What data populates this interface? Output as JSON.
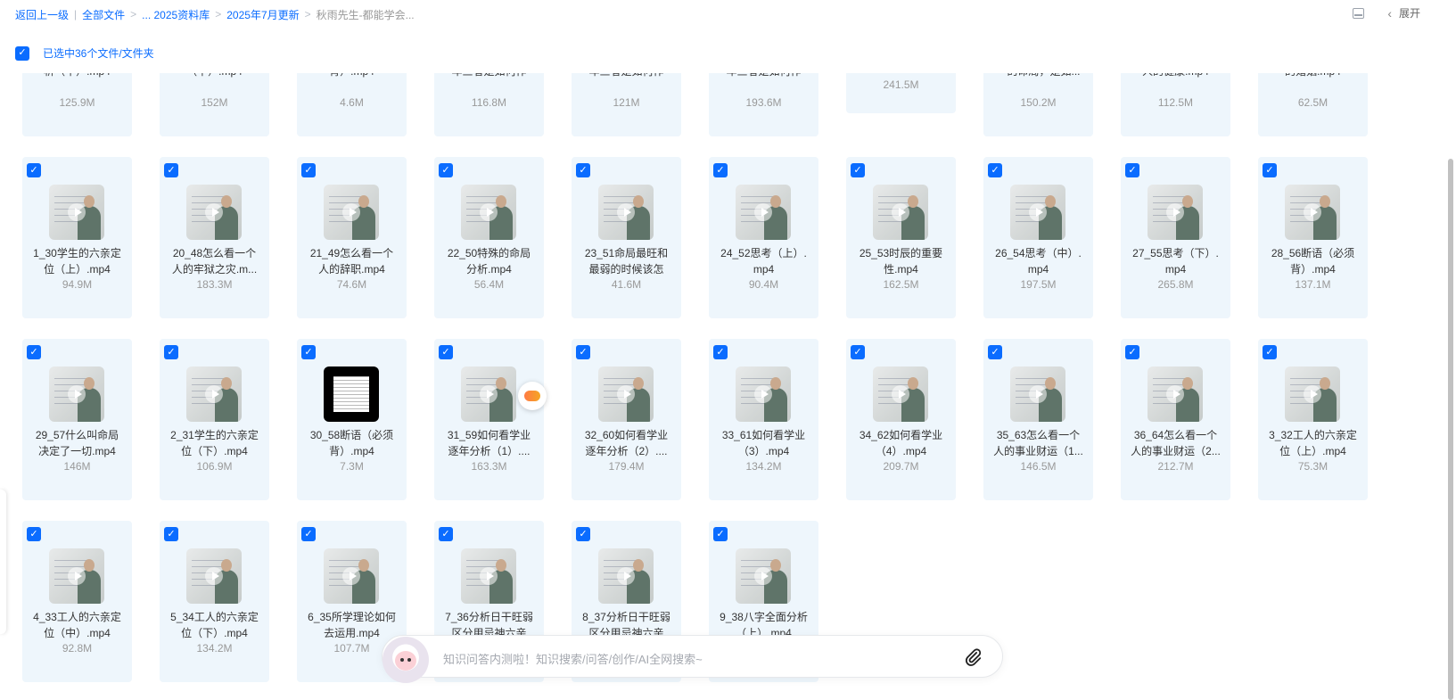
{
  "breadcrumb": {
    "back": "返回上一级",
    "all_files": "全部文件",
    "library": "... 2025资料库",
    "month": "2025年7月更新",
    "current": "秋雨先生-都能学会..."
  },
  "header": {
    "expand_label": "展开"
  },
  "selection": {
    "label": "已选中36个文件/文件夹"
  },
  "files": [
    {
      "name": "析（中）.mp4",
      "size": "125.9M",
      "thumb": "video"
    },
    {
      "name": "（下）.mp4",
      "size": "152M",
      "thumb": "video"
    },
    {
      "name": "背）.mp4",
      "size": "4.6M",
      "thumb": "video"
    },
    {
      "name": "年三者是如何作",
      "size": "116.8M",
      "thumb": "video"
    },
    {
      "name": "年三者是如何作",
      "size": "121M",
      "thumb": "video"
    },
    {
      "name": "年三者是如何作",
      "size": "193.6M",
      "thumb": "video"
    },
    {
      "name": "",
      "size": "241.5M",
      "thumb": "video",
      "short": true
    },
    {
      "name": "一的命局，是如...",
      "size": "150.2M",
      "thumb": "video"
    },
    {
      "name": "人的健康.mp4",
      "size": "112.5M",
      "thumb": "video"
    },
    {
      "name": "的婚姻.mp4",
      "size": "62.5M",
      "thumb": "video"
    },
    {
      "name": "1_30学生的六亲定位（上）.mp4",
      "size": "94.9M",
      "thumb": "video"
    },
    {
      "name": "20_48怎么看一个人的牢狱之灾.m...",
      "size": "183.3M",
      "thumb": "video"
    },
    {
      "name": "21_49怎么看一个人的辞职.mp4",
      "size": "74.6M",
      "thumb": "video"
    },
    {
      "name": "22_50特殊的命局分析.mp4",
      "size": "56.4M",
      "thumb": "video"
    },
    {
      "name": "23_51命局最旺和最弱的时候该怎",
      "size": "41.6M",
      "thumb": "video"
    },
    {
      "name": "24_52思考（上）.mp4",
      "size": "90.4M",
      "thumb": "video"
    },
    {
      "name": "25_53时辰的重要性.mp4",
      "size": "162.5M",
      "thumb": "video"
    },
    {
      "name": "26_54思考（中）.mp4",
      "size": "197.5M",
      "thumb": "video"
    },
    {
      "name": "27_55思考（下）.mp4",
      "size": "265.8M",
      "thumb": "video"
    },
    {
      "name": "28_56断语（必须背）.mp4",
      "size": "137.1M",
      "thumb": "video"
    },
    {
      "name": "29_57什么叫命局决定了一切.mp4",
      "size": "146M",
      "thumb": "video"
    },
    {
      "name": "2_31学生的六亲定位（下）.mp4",
      "size": "106.9M",
      "thumb": "video"
    },
    {
      "name": "30_58断语（必须背）.mp4",
      "size": "7.3M",
      "thumb": "doc"
    },
    {
      "name": "31_59如何看学业逐年分析（1）....",
      "size": "163.3M",
      "thumb": "video"
    },
    {
      "name": "32_60如何看学业逐年分析（2）....",
      "size": "179.4M",
      "thumb": "video"
    },
    {
      "name": "33_61如何看学业（3）.mp4",
      "size": "134.2M",
      "thumb": "video"
    },
    {
      "name": "34_62如何看学业（4）.mp4",
      "size": "209.7M",
      "thumb": "video"
    },
    {
      "name": "35_63怎么看一个人的事业财运（1...",
      "size": "146.5M",
      "thumb": "video"
    },
    {
      "name": "36_64怎么看一个人的事业财运（2...",
      "size": "212.7M",
      "thumb": "video"
    },
    {
      "name": "3_32工人的六亲定位（上）.mp4",
      "size": "75.3M",
      "thumb": "video"
    },
    {
      "name": "4_33工人的六亲定位（中）.mp4",
      "size": "92.8M",
      "thumb": "video"
    },
    {
      "name": "5_34工人的六亲定位（下）.mp4",
      "size": "134.2M",
      "thumb": "video"
    },
    {
      "name": "6_35所学理论如何去运用.mp4",
      "size": "107.7M",
      "thumb": "video"
    },
    {
      "name": "7_36分析日干旺弱区分用忌神六亲",
      "size": "",
      "thumb": "video"
    },
    {
      "name": "8_37分析日干旺弱区分用忌神六亲",
      "size": "",
      "thumb": "video"
    },
    {
      "name": "9_38八字全面分析（上）.mp4",
      "size": "",
      "thumb": "video"
    }
  ],
  "ask": {
    "placeholder": "知识问答内测啦！知识搜索/问答/创作/AI全网搜索~"
  },
  "colors": {
    "accent": "#0a6cff",
    "card_bg": "#eef6fc",
    "muted": "#999999"
  }
}
